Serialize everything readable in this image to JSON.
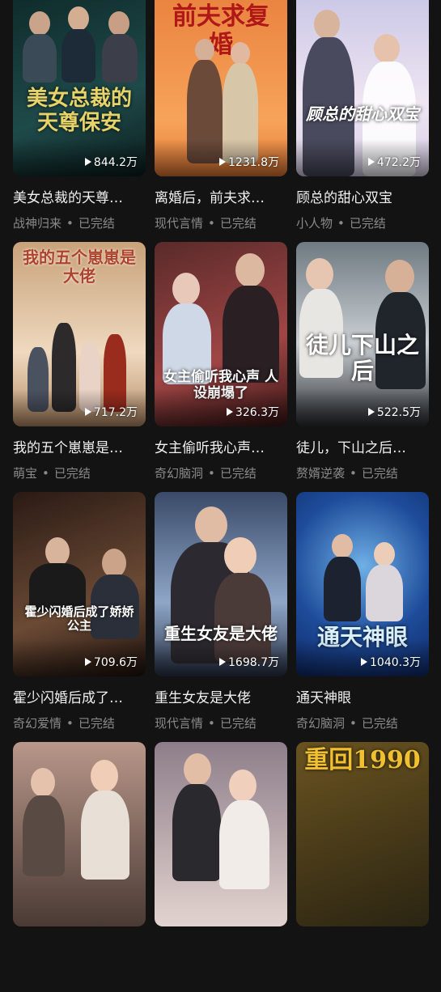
{
  "dramas": [
    {
      "title": "美女总裁的天尊…",
      "poster_text": "美女总裁的天尊保安",
      "views": "844.2万",
      "genre": "战神归来",
      "status": "已完结",
      "bg": [
        "#0e2a2a",
        "#1f4a4a"
      ],
      "accent": "#e6d36a"
    },
    {
      "title": "离婚后，前夫求…",
      "poster_text": "前夫求复婚",
      "views": "1231.8万",
      "genre": "现代言情",
      "status": "已完结",
      "bg": [
        "#e9823f",
        "#f7a35a"
      ],
      "accent": "#b01818"
    },
    {
      "title": "顾总的甜心双宝",
      "poster_text": "顾总的甜心双宝",
      "views": "472.2万",
      "genre": "小人物",
      "status": "已完结",
      "bg": [
        "#c9c6e6",
        "#efe6f2"
      ],
      "accent": "#ffffff"
    },
    {
      "title": "我的五个崽崽是…",
      "poster_text": "我的五个崽崽是大佬",
      "views": "717.2万",
      "genre": "萌宝",
      "status": "已完结",
      "bg": [
        "#c8a27a",
        "#efd9bf"
      ],
      "accent": "#b0432b"
    },
    {
      "title": "女主偷听我心声…",
      "poster_text": "女主偷听我心声 人设崩塌了",
      "views": "326.3万",
      "genre": "奇幻脑洞",
      "status": "已完结",
      "bg": [
        "#5a2a2a",
        "#a04545"
      ],
      "accent": "#ffffff"
    },
    {
      "title": "徒儿，下山之后…",
      "poster_text": "徒儿下山之后",
      "views": "522.5万",
      "genre": "赘婿逆袭",
      "status": "已完结",
      "bg": [
        "#6f7a82",
        "#c9ced2"
      ],
      "accent": "#ffffff"
    },
    {
      "title": "霍少闪婚后成了…",
      "poster_text": "霍少闪婚后成了娇娇公主",
      "views": "709.6万",
      "genre": "奇幻爱情",
      "status": "已完结",
      "bg": [
        "#2a1a14",
        "#6b4a35"
      ],
      "accent": "#ffffff"
    },
    {
      "title": "重生女友是大佬",
      "poster_text": "重生女友是大佬",
      "views": "1698.7万",
      "genre": "现代言情",
      "status": "已完结",
      "bg": [
        "#3a4a68",
        "#8fa6c8"
      ],
      "accent": "#ffffff"
    },
    {
      "title": "通天神眼",
      "poster_text": "通天神眼",
      "views": "1040.3万",
      "genre": "奇幻脑洞",
      "status": "已完结",
      "bg": [
        "#0f2a6a",
        "#3f7fc0"
      ],
      "accent": "#d8f0ff"
    },
    {
      "title": "",
      "poster_text": "",
      "views": "",
      "genre": "",
      "status": "",
      "bg": [
        "#4a3a34",
        "#b9978a"
      ],
      "accent": "#ffffff"
    },
    {
      "title": "",
      "poster_text": "",
      "views": "",
      "genre": "",
      "status": "",
      "bg": [
        "#8d7e8a",
        "#e3d3cf"
      ],
      "accent": "#ffffff"
    },
    {
      "title": "",
      "poster_text": "重回1990",
      "views": "",
      "genre": "",
      "status": "",
      "bg": [
        "#2a2412",
        "#6a5320"
      ],
      "accent": "#f0c030"
    }
  ]
}
